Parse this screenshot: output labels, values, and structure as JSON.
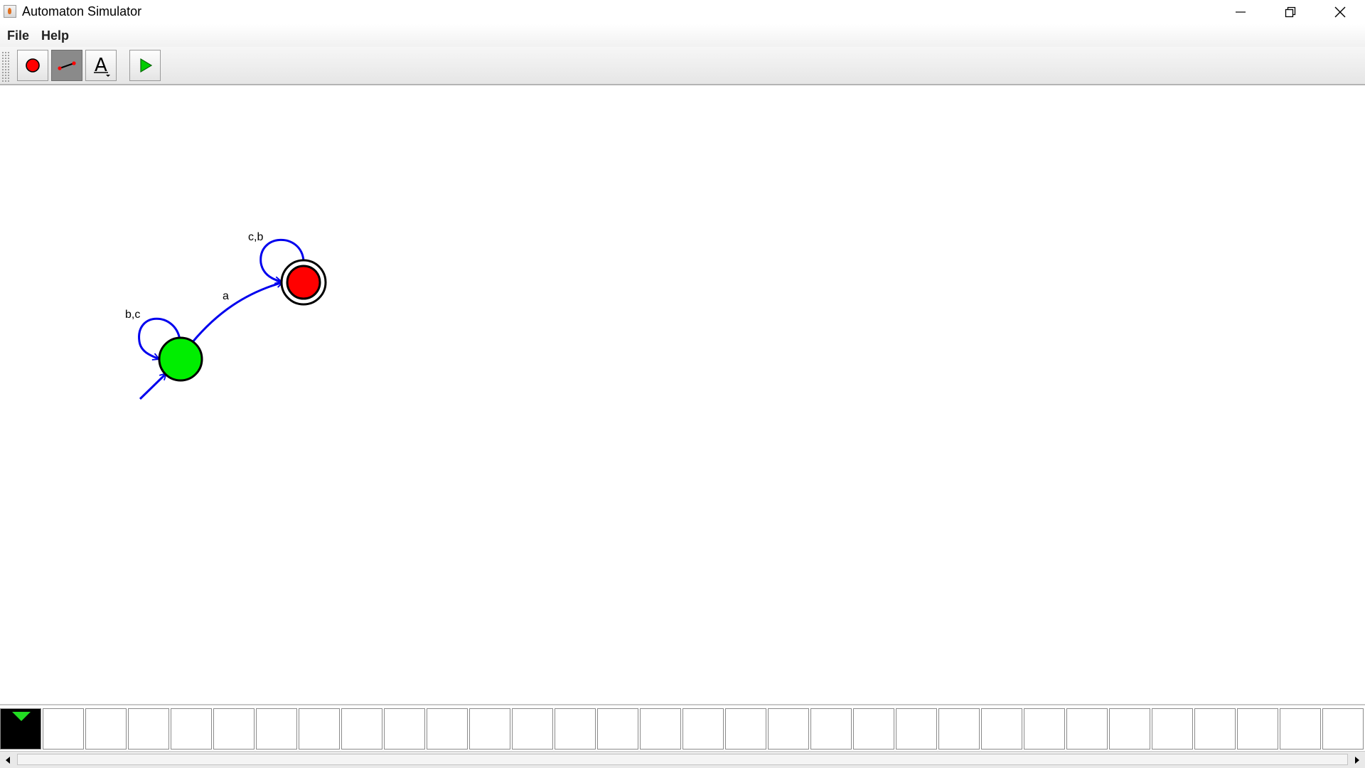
{
  "window": {
    "title": "Automaton Simulator",
    "controls": {
      "minimize_icon": "minimize-icon",
      "maximize_icon": "restore-icon",
      "close_icon": "close-icon"
    }
  },
  "menu": {
    "items": [
      {
        "label": "File"
      },
      {
        "label": "Help"
      }
    ]
  },
  "toolbar": {
    "tools": [
      {
        "name": "state-tool",
        "icon": "red-circle-icon",
        "pressed": false
      },
      {
        "name": "transition-tool",
        "icon": "transition-line-icon",
        "pressed": true
      },
      {
        "name": "text-tool",
        "icon": "text-icon",
        "glyph": "A",
        "pressed": false
      },
      {
        "name": "run-tool",
        "icon": "play-icon",
        "pressed": false
      }
    ]
  },
  "automaton": {
    "states": [
      {
        "id": "q0",
        "type": "start",
        "fill": "#00ee00",
        "accepting": false
      },
      {
        "id": "q1",
        "type": "accepting",
        "fill": "#ff0000",
        "accepting": true
      }
    ],
    "transitions": [
      {
        "from": "q0",
        "to": "q0",
        "label": "b,c"
      },
      {
        "from": "q0",
        "to": "q1",
        "label": "a"
      },
      {
        "from": "q1",
        "to": "q1",
        "label": "c,b"
      }
    ],
    "edge_color": "#0000ee"
  },
  "tape": {
    "cell_count": 32,
    "head_index": 0,
    "head_color": "#22dd22",
    "symbols": []
  }
}
